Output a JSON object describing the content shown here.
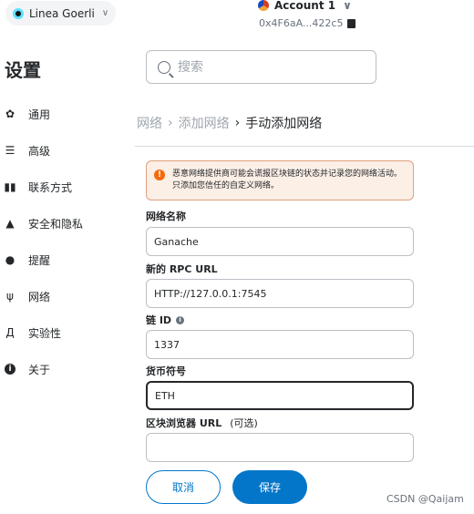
{
  "header": {
    "network_label": "Linea Goerli",
    "account_name": "Account 1",
    "account_address": "0x4F6aA...422c5"
  },
  "settings_title": "设置",
  "sidebar": {
    "items": [
      {
        "label": "通用",
        "icon": "gear-icon"
      },
      {
        "label": "高级",
        "icon": "sliders-icon"
      },
      {
        "label": "联系方式",
        "icon": "book-icon"
      },
      {
        "label": "安全和隐私",
        "icon": "lock-icon"
      },
      {
        "label": "提醒",
        "icon": "bell-icon"
      },
      {
        "label": "网络",
        "icon": "plug-icon"
      },
      {
        "label": "实验性",
        "icon": "flask-icon"
      },
      {
        "label": "关于",
        "icon": "info-icon"
      }
    ]
  },
  "search": {
    "placeholder": "搜索"
  },
  "breadcrumb": {
    "first": "网络",
    "second": "添加网络",
    "current": "手动添加网络",
    "separator": "›"
  },
  "warning": {
    "text": "恶意网络提供商可能会谎报区块链的状态并记录您的网络活动。只添加您信任的自定义网络。"
  },
  "form": {
    "network_name_label": "网络名称",
    "network_name_value": "Ganache",
    "rpc_url_label": "新的 RPC URL",
    "rpc_url_value": "HTTP://127.0.0.1:7545",
    "chain_id_label": "链 ID",
    "chain_id_value": "1337",
    "currency_symbol_label": "货币符号",
    "currency_symbol_value": "ETH",
    "explorer_url_label": "区块浏览器 URL",
    "explorer_url_optional": "(可选)",
    "explorer_url_value": ""
  },
  "buttons": {
    "cancel": "取消",
    "save": "保存"
  },
  "watermark": "CSDN @Qaijam",
  "colors": {
    "accent": "#0376c9",
    "warning_bg": "#fbefe6",
    "warning_icon": "#f66a0a"
  }
}
